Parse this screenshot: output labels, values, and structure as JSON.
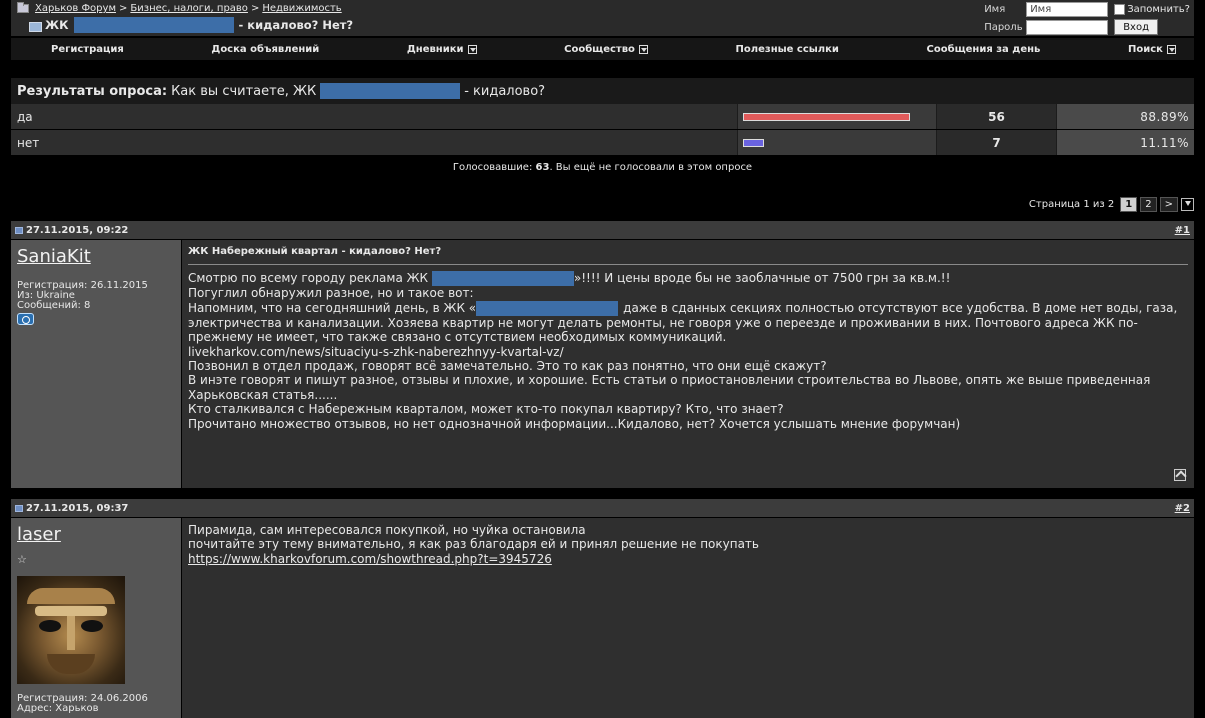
{
  "header": {
    "breadcrumb": {
      "forum": "Харьков Форум",
      "sep1": ">",
      "section": "Бизнес, налоги, право",
      "sep2": ">",
      "subsection": "Недвижимость"
    },
    "thread_title": {
      "prefix": "ЖК",
      "suffix": "- кидалово? Нет?"
    }
  },
  "login": {
    "name_label": "Имя",
    "name_placeholder": "Имя",
    "password_label": "Пароль",
    "remember_label": "Запомнить?",
    "submit_label": "Вход"
  },
  "nav": {
    "items": [
      {
        "label": "Регистрация",
        "dropdown": false
      },
      {
        "label": "Доска объявлений",
        "dropdown": false
      },
      {
        "label": "Дневники",
        "dropdown": true
      },
      {
        "label": "Сообщество",
        "dropdown": true
      },
      {
        "label": "Полезные ссылки",
        "dropdown": false
      },
      {
        "label": "Сообщения за день",
        "dropdown": false
      },
      {
        "label": "Поиск",
        "dropdown": true
      }
    ]
  },
  "poll": {
    "title_bold": "Результаты опроса",
    "title_colon": ":",
    "question_prefix": "Как вы считаете, ЖК",
    "question_suffix": "- кидалово?",
    "options": [
      {
        "label": "да",
        "votes": "56",
        "percent": "88.89%",
        "fraction": 0.8889,
        "color": "#e05a5a"
      },
      {
        "label": "нет",
        "votes": "7",
        "percent": "11.11%",
        "fraction": 0.1111,
        "color": "#6a63e0"
      }
    ],
    "voters_prefix": "Голосовавшие:",
    "voters_count": "63",
    "voters_suffix": ". Вы ещё не голосовали в этом опросе"
  },
  "pager": {
    "label": "Страница 1 из 2",
    "pages": [
      "1",
      "2"
    ],
    "current": "1",
    "next": ">"
  },
  "posts": [
    {
      "date": "27.11.2015, 09:22",
      "number": "#1",
      "username": "SaniaKit",
      "info": [
        "Регистрация: 26.11.2015",
        "Из: Ukraine",
        "Сообщений: 8"
      ],
      "title": "ЖК Набережный квартал - кидалово? Нет?",
      "lines": {
        "l1a": "Смотрю по всему городу реклама ЖК",
        "l1b": "»!!!! И цены вроде бы не заоблачные от 7500 грн за кв.м.!!",
        "l2": "Погуглил обнаружил разное, но и такое вот:",
        "l3a": "Напомним, что на сегодняшний день, в ЖК «",
        "l3b": "даже в сданных секциях полностью отсутствуют все удобства. В доме нет воды, газа, электричества и канализации. Хозяева квартир не могут делать ремонты, не говоря уже о переезде и проживании в них. Почтового адреса ЖК по-прежнему не имеет, что также связано с отсутствием необходимых коммуникаций.",
        "l4": "livekharkov.com/news/situaciyu-s-zhk-naberezhnyy-kvartal-vz/",
        "l5": "Позвонил в отдел продаж, говорят всё замечательно. Это то как раз понятно, что они ещё скажут?",
        "l6": "В инэте говорят и пишут разное, отзывы и плохие, и хорошие. Есть статьи о приостановлении строительства во Львове, опять же выше приведенная Харьковская статья......",
        "l7": "Кто сталкивался с Набережным кварталом, может кто-то покупал квартиру? Кто, что знает?",
        "l8": "Прочитано множество отзывов, но нет однозначной информации...Кидалово, нет? Хочется услышать мнение форумчан)"
      }
    },
    {
      "date": "27.11.2015, 09:37",
      "number": "#2",
      "username": "laser",
      "star": "☆",
      "info": [
        "Регистрация: 24.06.2006",
        "Адрес: Харьков"
      ],
      "lines": {
        "l1": "Пирамида, сам интересовался покупкой, но чуйка остановила",
        "l2": "почитайте эту тему внимательно, я как раз благодаря ей и принял решение не покупать",
        "link": "https://www.kharkovforum.com/showthread.php?t=3945726"
      }
    }
  ]
}
